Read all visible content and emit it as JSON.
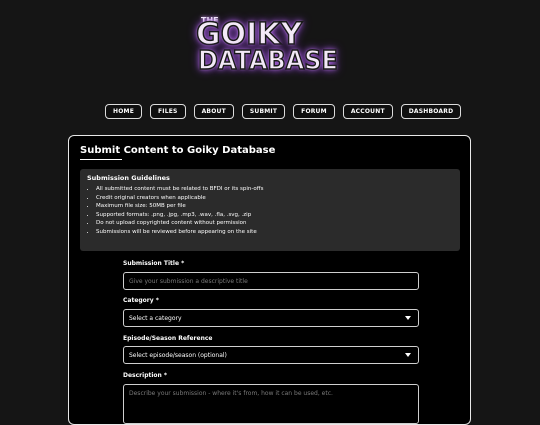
{
  "logo": {
    "the": "THE",
    "line1": "GOIKY",
    "line2": "DATABASE"
  },
  "nav": [
    "HOME",
    "FILES",
    "ABOUT",
    "SUBMIT",
    "FORUM",
    "ACCOUNT",
    "DASHBOARD"
  ],
  "panel": {
    "title": "Submit Content to Goiky Database",
    "guidelines": {
      "heading": "Submission Guidelines",
      "items": [
        "All submitted content must be related to BFDI or its spin-offs",
        "Credit original creators when applicable",
        "Maximum file size: 50MB per file",
        "Supported formats: .png, .jpg, .mp3, .wav, .fla, .svg, .zip",
        "Do not upload copyrighted content without permission",
        "Submissions will be reviewed before appearing on the site"
      ]
    },
    "form": {
      "title_label": "Submission Title *",
      "title_placeholder": "Give your submission a descriptive title",
      "category_label": "Category *",
      "category_value": "Select a category",
      "episode_label": "Episode/Season Reference",
      "episode_value": "Select episode/season (optional)",
      "description_label": "Description *",
      "description_placeholder": "Describe your submission - where it's from, how it can be used, etc."
    }
  }
}
